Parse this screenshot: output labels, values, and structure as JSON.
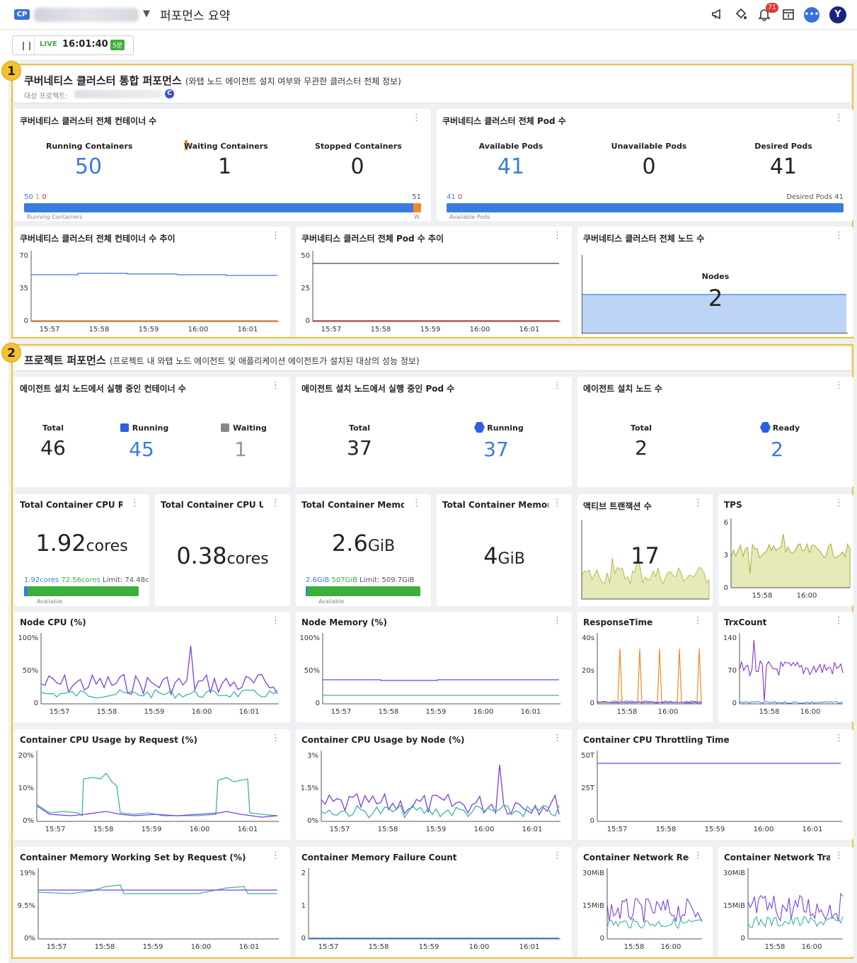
{
  "topbar": {
    "badge": "CP",
    "title": "퍼포먼스 요약",
    "bell_count": "71",
    "avatar": "Y",
    "icons": [
      "megaphone-icon",
      "paint-bucket-icon",
      "bell-icon",
      "calendar-icon",
      "chat-icon"
    ]
  },
  "live": {
    "label": "LIVE",
    "time": "16:01:40",
    "range": "5분"
  },
  "section1": {
    "number": "1",
    "title": "쿠버네티스 클러스터 통합 퍼포먼스",
    "subtitle": "(와탭 노드 에이전트 설치 여부와 무관한 클러스터 전체 정보)",
    "target_label": "대상 프로젝트:",
    "target_badge": "C",
    "containers": {
      "title": "쿠버네티스 클러스터 전체 컨테이너 수",
      "running_label": "Running Containers",
      "running": "50",
      "waiting_label": "Waiting Containers",
      "waiting": "1",
      "stopped_label": "Stopped Containers",
      "stopped": "0",
      "bar_v1": "50",
      "bar_v2": "1",
      "bar_v3": "0",
      "bar_max": "51",
      "bar_left_label": "Running Containers",
      "bar_right_label": "W.",
      "running_fraction": 0.98
    },
    "pods": {
      "title": "쿠버네티스 클러스터 전체 Pod 수",
      "available_label": "Available Pods",
      "available": "41",
      "unavailable_label": "Unavailable Pods",
      "unavailable": "0",
      "desired_label": "Desired Pods",
      "desired": "41",
      "bar_v1": "41",
      "bar_v2": "0",
      "bar_right": "Desired Pods 41",
      "bar_left_label": "Available Pods",
      "available_fraction": 1.0
    },
    "container_trend": {
      "title": "쿠버네티스 클러스터 전체 컨테이너 수 추이",
      "yticks": [
        "70",
        "35",
        "0"
      ]
    },
    "pod_trend": {
      "title": "쿠버네티스 클러스터 전체 Pod 수 추이",
      "yticks": [
        "50",
        "25",
        "0"
      ]
    },
    "nodes": {
      "title": "쿠버네티스 클러스터 전체 노드 수",
      "label": "Nodes",
      "value": "2"
    }
  },
  "section2": {
    "number": "2",
    "title": "프로젝트 퍼포먼스",
    "subtitle": "(프로젝트 내 와탭 노드 에이전트 및 애플리케이션 에이전트가 설치된 대상의 성능 정보)",
    "agent_containers": {
      "title": "에이전트 설치 노드에서 실행 중인 컨테이너 수",
      "total_label": "Total",
      "total": "46",
      "running_label": "Running",
      "running": "45",
      "waiting_label": "Waiting",
      "waiting": "1"
    },
    "agent_pods": {
      "title": "에이전트 설치 노드에서 실행 중인 Pod 수",
      "total_label": "Total",
      "total": "37",
      "running_label": "Running",
      "running": "37"
    },
    "agent_nodes": {
      "title": "에이전트 설치 노드 수",
      "total_label": "Total",
      "total": "2",
      "ready_label": "Ready",
      "ready": "2"
    },
    "cpu_req": {
      "title": "Total Container CPU Rec",
      "value": "1.92",
      "unit": "cores",
      "bar_a": "1.92cores",
      "bar_b": "72.56cores",
      "limit": "Limit: 74.48c",
      "bar_label": "Available",
      "used_fraction": 0.03
    },
    "cpu_usage": {
      "title": "Total Container CPU Usa",
      "value": "0.38",
      "unit": "cores"
    },
    "mem_req": {
      "title": "Total Container Memory",
      "value": "2.6",
      "unit": "GiB",
      "bar_a": "2.6GiB",
      "bar_b": "507GiB",
      "limit": "Limit: 509.7GiB",
      "bar_label": "Available",
      "used_fraction": 0.01
    },
    "mem_usage": {
      "title": "Total Container Memory",
      "value": "4",
      "unit": "GiB"
    },
    "active_tx": {
      "title": "액티브 트랜잭션 수",
      "value": "17"
    },
    "tps": {
      "title": "TPS",
      "yticks": [
        "6",
        "3",
        "0"
      ],
      "xticks": [
        "15:58",
        "16:00"
      ]
    },
    "node_cpu": {
      "title": "Node CPU (%)",
      "yticks": [
        "100%",
        "50%",
        "0"
      ]
    },
    "node_mem": {
      "title": "Node Memory (%)",
      "yticks": [
        "100%",
        "50%",
        "0"
      ]
    },
    "response_time": {
      "title": "ResponseTime",
      "yticks": [
        "40s",
        "20s",
        "0"
      ],
      "xticks": [
        "15:58",
        "16:00"
      ]
    },
    "trx_count": {
      "title": "TrxCount",
      "yticks": [
        "140",
        "70",
        "0"
      ],
      "xticks": [
        "15:58",
        "16:00"
      ]
    },
    "cpu_by_req": {
      "title": "Container CPU Usage by Request (%)",
      "yticks": [
        "20%",
        "10%",
        "0%"
      ]
    },
    "cpu_by_node": {
      "title": "Container CPU Usage by Node (%)",
      "yticks": [
        "3%",
        "1.5%",
        "0%"
      ]
    },
    "cpu_throttle": {
      "title": "Container CPU Throttling Time",
      "yticks": [
        "50T",
        "25T",
        "0"
      ]
    },
    "mem_ws": {
      "title": "Container Memory Working Set by Request (%)",
      "yticks": [
        "19%",
        "9.5%",
        "0%"
      ]
    },
    "mem_fail": {
      "title": "Container Memory Failure Count",
      "yticks": [
        "2",
        "1",
        "0"
      ]
    },
    "net_rx": {
      "title": "Container Network Rece",
      "yticks": [
        "30MiB",
        "15MiB",
        "0"
      ],
      "xticks": [
        "15:58",
        "16:00"
      ]
    },
    "net_tx": {
      "title": "Container Network Trans",
      "yticks": [
        "30MiB",
        "15MiB",
        "0"
      ],
      "xticks": [
        "15:58",
        "16:00"
      ]
    }
  },
  "time_ticks": [
    "15:57",
    "15:58",
    "15:59",
    "16:00",
    "16:01"
  ],
  "colors": {
    "accent": "#3a7be0",
    "section_border": "#f5c12e",
    "purple": "#7b3fe4",
    "teal": "#3bb3a3",
    "orange": "#f08a24",
    "live_green": "#3cae3c"
  }
}
